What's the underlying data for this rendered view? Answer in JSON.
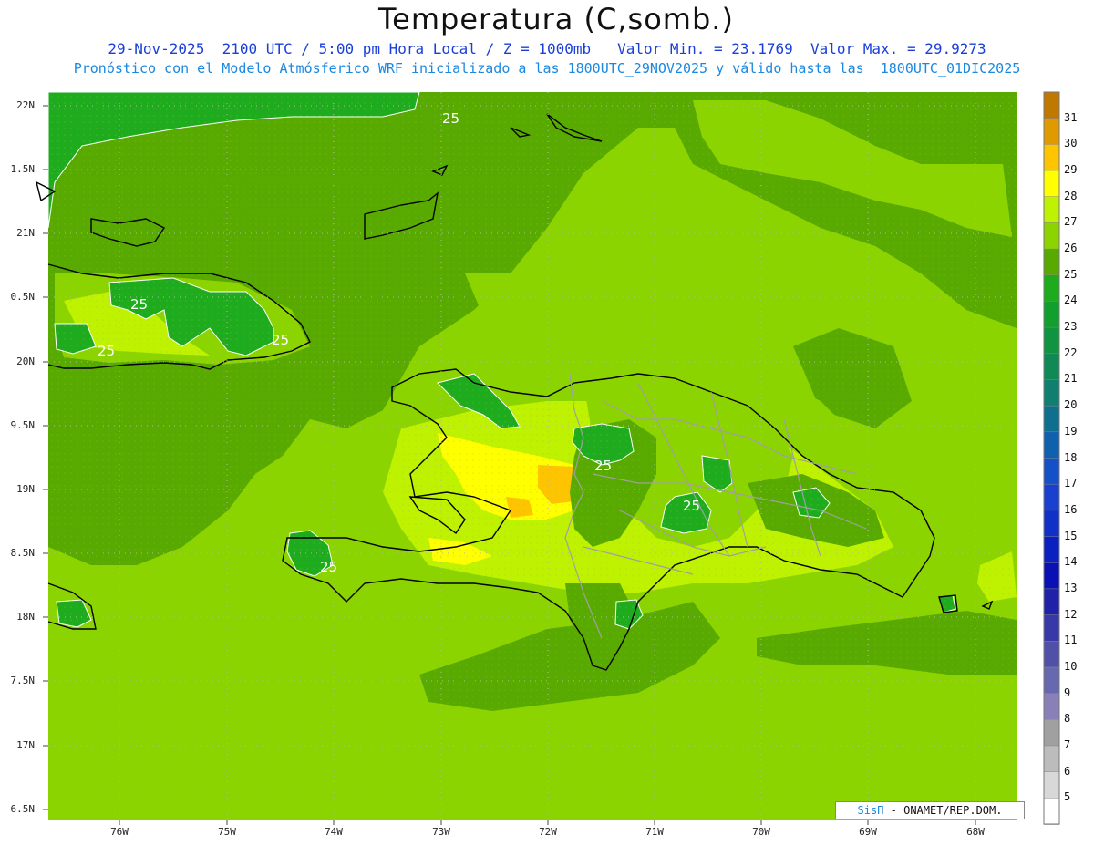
{
  "header": {
    "title": "Temperatura (C,somb.)",
    "line1": "29-Nov-2025  2100 UTC / 5:00 pm Hora Local / Z = 1000mb   Valor Min. = 23.1769  Valor Max. = 29.9273",
    "line2": "Pronóstico con el Modelo Atmósferico WRF inicializado a las 1800UTC_29NOV2025 y válido hasta las  1800UTC_01DIC2025"
  },
  "axes": {
    "lat_labels": [
      "22N",
      "1.5N",
      "21N",
      "0.5N",
      "20N",
      "9.5N",
      "19N",
      "8.5N",
      "18N",
      "7.5N",
      "17N",
      "6.5N"
    ],
    "lon_labels": [
      "76W",
      "75W",
      "74W",
      "73W",
      "72W",
      "71W",
      "70W",
      "69W",
      "68W"
    ]
  },
  "contour_labels": [
    "25",
    "25",
    "25",
    "25",
    "25",
    "25",
    "25"
  ],
  "colorbar": {
    "labels": [
      "31",
      "30",
      "29",
      "28",
      "27",
      "26",
      "25",
      "24",
      "23",
      "22",
      "21",
      "20",
      "19",
      "18",
      "17",
      "16",
      "15",
      "14",
      "13",
      "12",
      "11",
      "10",
      "9",
      "8",
      "7",
      "6",
      "5"
    ],
    "colors": [
      "#c07800",
      "#e09a00",
      "#ffc400",
      "#ffff00",
      "#bff200",
      "#8cd400",
      "#58aa00",
      "#1eac1e",
      "#11a02d",
      "#0f9440",
      "#108a55",
      "#0f7f70",
      "#0e6f8f",
      "#1060b0",
      "#1450c8",
      "#1a40d0",
      "#1030c8",
      "#0a20c0",
      "#0a10b4",
      "#2020a8",
      "#3838a8",
      "#5050a8",
      "#6868b0",
      "#8a80b8",
      "#a0a0a0",
      "#bcbcbc",
      "#d8d8d8",
      "#ffffff"
    ]
  },
  "credit": {
    "brand": "SisΠ",
    "org": " - ONAMET/REP.DOM."
  }
}
